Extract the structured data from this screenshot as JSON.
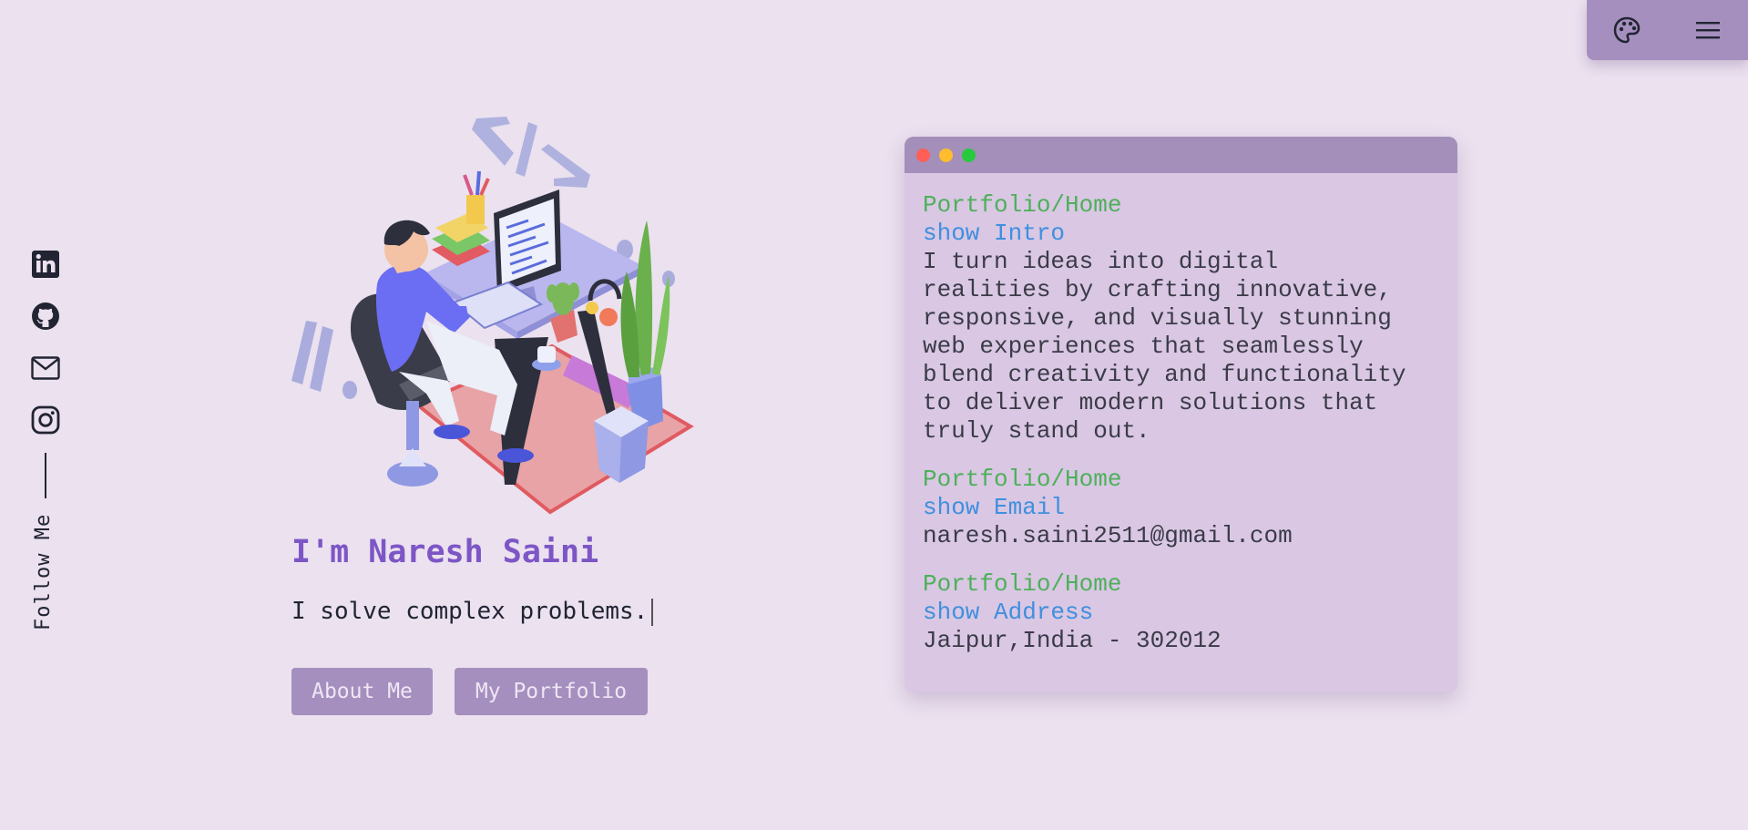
{
  "topbar": {
    "theme_icon": "palette-icon",
    "menu_icon": "hamburger-menu-icon",
    "background": "#a58fbe"
  },
  "social": {
    "items": [
      {
        "name": "linkedin",
        "icon": "linkedin-icon"
      },
      {
        "name": "github",
        "icon": "github-icon"
      },
      {
        "name": "email",
        "icon": "mail-icon"
      },
      {
        "name": "instagram",
        "icon": "instagram-icon"
      }
    ],
    "follow_label": "Follow Me"
  },
  "hero": {
    "illustration": "developer-at-desk-illustration",
    "name": "I'm Naresh Saini",
    "tagline": "I solve complex problems.",
    "buttons": {
      "about": "About Me",
      "portfolio": "My Portfolio"
    }
  },
  "terminal": {
    "blocks": [
      {
        "path": "Portfolio/Home",
        "command": "show Intro",
        "output": "I turn ideas into digital\nrealities by crafting innovative,\nresponsive, and visually stunning\nweb experiences that seamlessly\nblend creativity and functionality\nto deliver modern solutions that\ntruly stand out."
      },
      {
        "path": "Portfolio/Home",
        "command": "show Email",
        "output": "naresh.saini2511@gmail.com"
      },
      {
        "path": "Portfolio/Home",
        "command": "show Address",
        "output": "Jaipur,India - 302012"
      }
    ]
  },
  "colors": {
    "background": "#ebe1ef",
    "accent": "#7d56c6",
    "button": "#a58fbe",
    "terminal_bg": "#d9c7e3",
    "terminal_header": "#a38fba",
    "path_green": "#4db05a",
    "command_blue": "#3f8fdf",
    "dot_red": "#ff5f56",
    "dot_yellow": "#ffbd2e",
    "dot_green": "#27c93f"
  }
}
